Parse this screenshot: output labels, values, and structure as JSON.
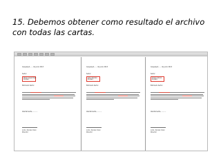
{
  "slide": {
    "title": "15. Debemos obtener como resultado el archivo con todas las cartas."
  },
  "preview": {
    "pages": [
      {
        "date": "Guayaquil, …. de junio 2013",
        "greeting": "Señor:",
        "address_line1": "Paulo Cesar Diaz",
        "address_line2": "Ciudad",
        "salutation": "Estimado Señor:",
        "closing": "Atentamente, ………",
        "signature_line1": "Lcdo. Xxxxxx Xxxx",
        "signature_line2": "Director"
      },
      {
        "date": "Guayaquil, …. de junio 2013",
        "greeting": "Señor:",
        "address_line1": "Juan Xxxxxx",
        "address_line2": "Ciudad",
        "salutation": "Estimado Señor:",
        "closing": "Atentamente, ………",
        "signature_line1": "Lcdo. Xxxxxx Xxxx",
        "signature_line2": "Director"
      },
      {
        "date": "Guayaquil, …. de junio 2013",
        "greeting": "Señor:",
        "address_line1": "Xxxxx Xxxxx",
        "address_line2": "Ciudad",
        "salutation": "Estimado Señor:",
        "closing": "Atentamente, ………",
        "signature_line1": "Lcdo. Xxxxxx Xxxx",
        "signature_line2": "Director"
      }
    ]
  },
  "colors": {
    "highlight": "#e03a2f",
    "text": "#000000",
    "window_border": "#b9b9b9"
  }
}
